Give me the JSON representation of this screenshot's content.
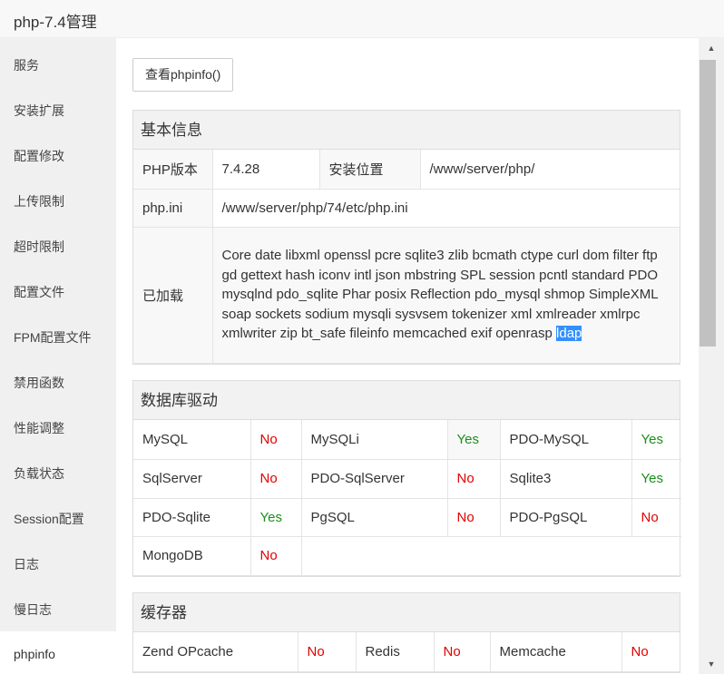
{
  "window": {
    "title": "php-7.4管理"
  },
  "sidebar": {
    "items": [
      {
        "label": "服务"
      },
      {
        "label": "安装扩展"
      },
      {
        "label": "配置修改"
      },
      {
        "label": "上传限制"
      },
      {
        "label": "超时限制"
      },
      {
        "label": "配置文件"
      },
      {
        "label": "FPM配置文件"
      },
      {
        "label": "禁用函数"
      },
      {
        "label": "性能调整"
      },
      {
        "label": "负载状态"
      },
      {
        "label": "Session配置"
      },
      {
        "label": "日志"
      },
      {
        "label": "慢日志"
      },
      {
        "label": "phpinfo"
      }
    ],
    "active": "phpinfo"
  },
  "toolbar": {
    "phpinfo_button": "查看phpinfo()"
  },
  "basic_info": {
    "heading": "基本信息",
    "version_label": "PHP版本",
    "version_value": "7.4.28",
    "install_label": "安装位置",
    "install_value": "/www/server/php/",
    "ini_label": "php.ini",
    "ini_value": "/www/server/php/74/etc/php.ini",
    "loaded_label": "已加载",
    "loaded_text": "Core date libxml openssl pcre sqlite3 zlib bcmath ctype curl dom filter ftp gd gettext hash iconv intl json mbstring SPL session pcntl standard PDO mysqlnd pdo_sqlite Phar posix Reflection pdo_mysql shmop SimpleXML soap sockets sodium mysqli sysvsem tokenizer xml xmlreader xmlrpc xmlwriter zip bt_safe fileinfo memcached exif openrasp",
    "loaded_selected": "ldap"
  },
  "db_drivers": {
    "heading": "数据库驱动",
    "rows": [
      [
        {
          "name": "MySQL",
          "status": "No"
        },
        {
          "name": "MySQLi",
          "status": "Yes"
        },
        {
          "name": "PDO-MySQL",
          "status": "Yes"
        }
      ],
      [
        {
          "name": "SqlServer",
          "status": "No"
        },
        {
          "name": "PDO-SqlServer",
          "status": "No"
        },
        {
          "name": "Sqlite3",
          "status": "Yes"
        }
      ],
      [
        {
          "name": "PDO-Sqlite",
          "status": "Yes"
        },
        {
          "name": "PgSQL",
          "status": "No"
        },
        {
          "name": "PDO-PgSQL",
          "status": "No"
        }
      ],
      [
        {
          "name": "MongoDB",
          "status": "No"
        }
      ]
    ]
  },
  "cache": {
    "heading": "缓存器",
    "rows": [
      [
        {
          "name": "Zend OPcache",
          "status": "No"
        },
        {
          "name": "Redis",
          "status": "No"
        },
        {
          "name": "Memcache",
          "status": "No"
        }
      ]
    ]
  },
  "colors": {
    "no": "#e00000",
    "yes": "#1a8f1a",
    "selection": "#3390ff"
  },
  "scrollbar": {
    "position_fraction": 0.0,
    "visible_fraction": 0.45
  }
}
